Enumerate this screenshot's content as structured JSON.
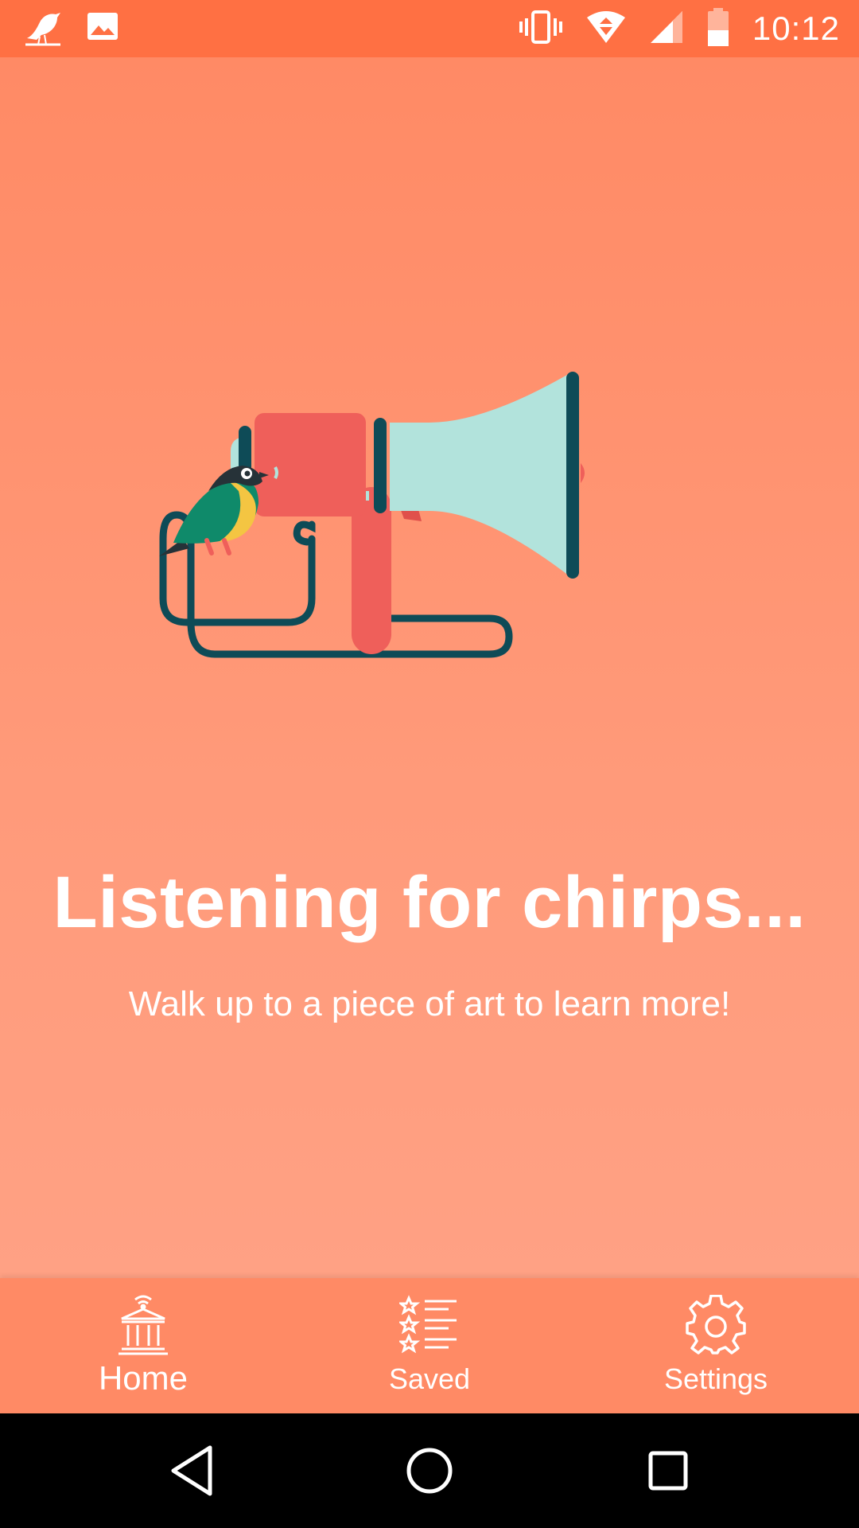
{
  "status_bar": {
    "time": "10:12",
    "left_icons": [
      "bird-logo-icon",
      "image-icon"
    ],
    "right_icons": [
      "vibrate-icon",
      "wifi-icon",
      "cell-signal-icon",
      "battery-icon"
    ]
  },
  "main": {
    "headline": "Listening for chirps...",
    "subtitle": "Walk up to a piece of art to learn more!"
  },
  "bottom_nav": {
    "items": [
      {
        "label": "Home",
        "icon": "museum-icon",
        "active": true
      },
      {
        "label": "Saved",
        "icon": "saved-list-icon",
        "active": false
      },
      {
        "label": "Settings",
        "icon": "gear-icon",
        "active": false
      }
    ]
  },
  "system_nav": {
    "buttons": [
      "back-icon",
      "home-circle-icon",
      "recents-icon"
    ]
  },
  "colors": {
    "status_bar": "#ff7043",
    "background": "#ff8a65",
    "megaphone_body": "#ef5f5a",
    "megaphone_horn": "#b2e3dc",
    "cable": "#0e4b57",
    "bird_green": "#0f8a6a",
    "bird_yellow": "#f4c542"
  }
}
